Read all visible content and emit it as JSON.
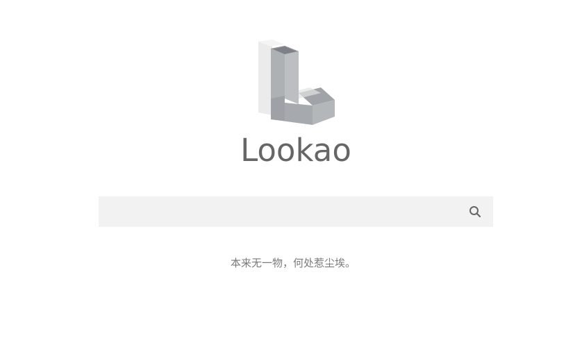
{
  "brand": {
    "name": "Lookao",
    "logo_icon": "letter-l-3d-logo-icon"
  },
  "search": {
    "value": "",
    "placeholder": "",
    "button_icon": "search-icon"
  },
  "tagline": "本来无一物，何处惹尘埃。",
  "colors": {
    "brand_text": "#666666",
    "search_bg": "#f2f2f2",
    "tagline_text": "#7a7a7a",
    "logo_gray": "#a7abaf",
    "logo_light": "#ececec"
  }
}
